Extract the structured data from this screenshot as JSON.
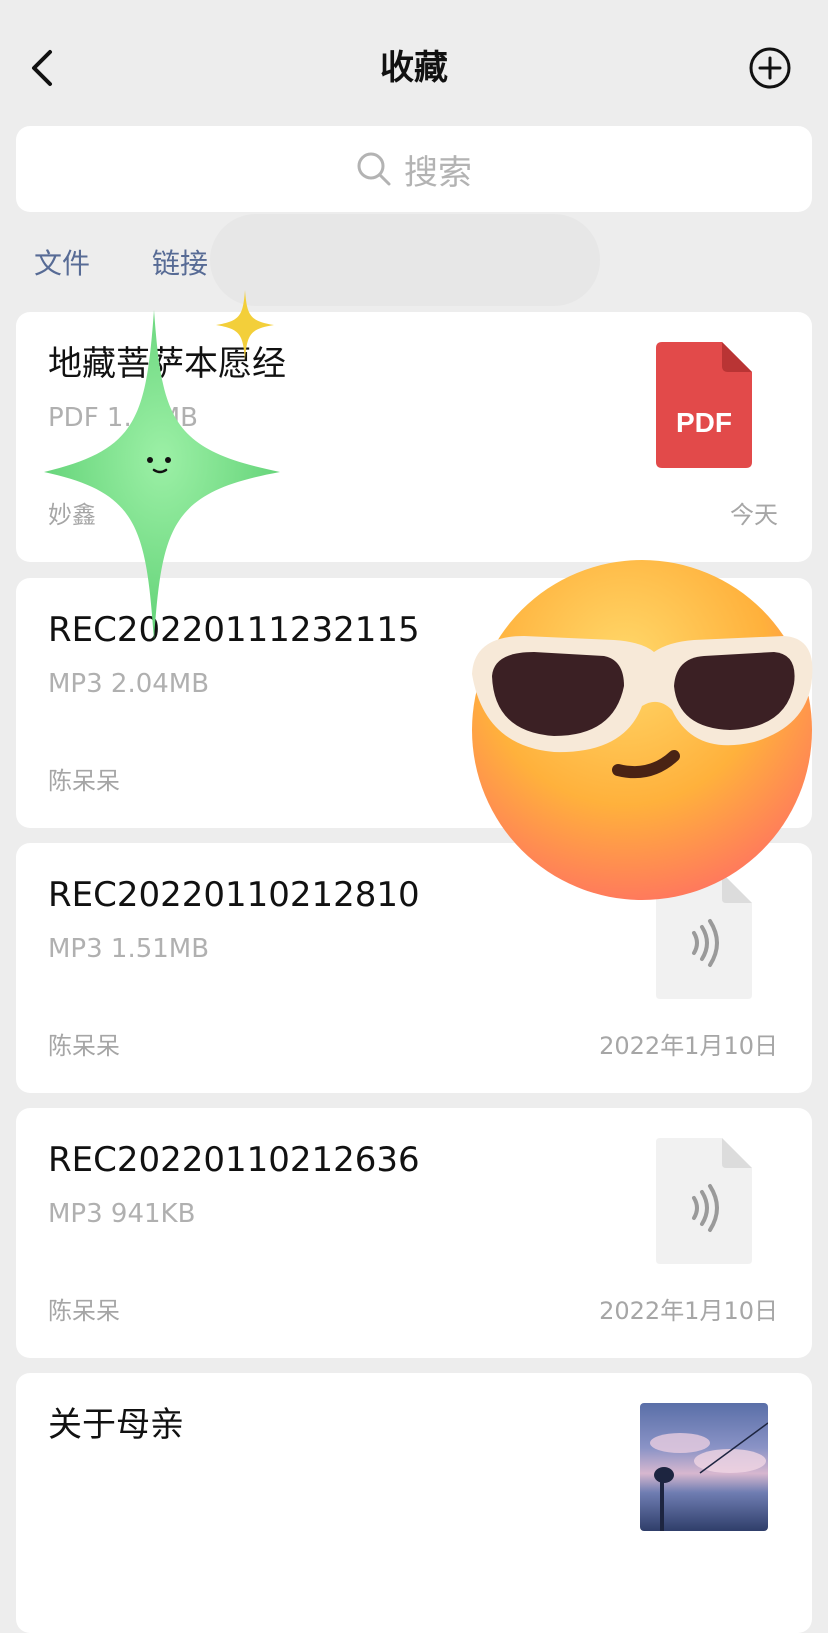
{
  "header": {
    "title": "收藏",
    "back_icon": "chevron-left-icon",
    "add_icon": "plus-circle-icon"
  },
  "search": {
    "placeholder": "搜索",
    "icon": "search-icon"
  },
  "filters": [
    "文件",
    "链接"
  ],
  "items": [
    {
      "title": "地藏菩萨本愿经",
      "meta": "PDF 1.__MB",
      "user": "妙鑫",
      "date": "今天",
      "type": "pdf",
      "icon_label": "PDF"
    },
    {
      "title": "REC20220111232115",
      "meta": "MP3 2.04MB",
      "user": "陈呆呆",
      "date": "",
      "type": "audio"
    },
    {
      "title": "REC20220110212810",
      "meta": "MP3 1.51MB",
      "user": "陈呆呆",
      "date": "2022年1月10日",
      "type": "audio"
    },
    {
      "title": "REC20220110212636",
      "meta": "MP3 941KB",
      "user": "陈呆呆",
      "date": "2022年1月10日",
      "type": "audio"
    },
    {
      "title": "关于母亲",
      "type": "note-with-image"
    }
  ],
  "stickers": [
    "sparkle-star-sticker",
    "small-sparkle-sticker",
    "sunglasses-emoji-sticker"
  ],
  "colors": {
    "background": "#ededed",
    "link": "#576b95",
    "pdf_red": "#e24a4a"
  }
}
